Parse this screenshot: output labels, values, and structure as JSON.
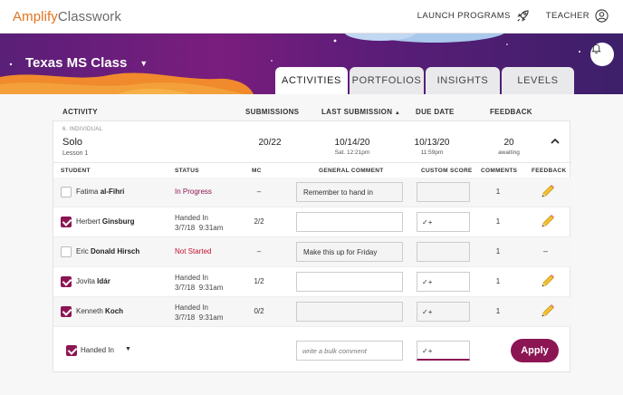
{
  "app": {
    "brand": "Amplify",
    "product": "Classwork",
    "launch_label": "LAUNCH PROGRAMS",
    "user_label": "TEACHER"
  },
  "banner": {
    "class_name": "Texas MS Class"
  },
  "tabs": [
    {
      "label": "ACTIVITIES",
      "active": true
    },
    {
      "label": "PORTFOLIOS",
      "active": false
    },
    {
      "label": "INSIGHTS",
      "active": false
    },
    {
      "label": "LEVELS",
      "active": false
    }
  ],
  "columns": {
    "activity": "ACTIVITY",
    "submissions": "SUBMISSIONS",
    "last_submission": "LAST SUBMISSION",
    "due_date": "DUE DATE",
    "feedback": "FEEDBACK"
  },
  "activity": {
    "type": "6. INDIVIDUAL",
    "name": "Solo",
    "lesson": "Lesson 1",
    "submissions": "20/22",
    "last_submission_date": "10/14/20",
    "last_submission_time": "Sat. 12:21pm",
    "due_date": "10/13/20",
    "due_time": "11:59pm",
    "feedback_count": "20",
    "feedback_sub": "awaiting"
  },
  "student_columns": {
    "student": "STUDENT",
    "status": "STATUS",
    "mc": "MC",
    "general_comment": "GENERAL COMMENT",
    "custom_score": "CUSTOM SCORE",
    "comments": "COMMENTS",
    "feedback": "FEEDBACK"
  },
  "students": [
    {
      "first": "Fatima",
      "last": "al-Fihri",
      "checked": false,
      "status": "In Progress",
      "status_type": "prog",
      "status_date": "",
      "status_time": "",
      "mc": "–",
      "comment": "Remember to hand in",
      "score": "",
      "comments": "1",
      "feedback": "pencil"
    },
    {
      "first": "Herbert",
      "last": "Ginsburg",
      "checked": true,
      "status": "Handed In",
      "status_type": "done",
      "status_date": "3/7/18",
      "status_time": "9:31am",
      "mc": "2/2",
      "comment": "",
      "score": "✓+",
      "comments": "1",
      "feedback": "pencil"
    },
    {
      "first": "Eric",
      "last": "Donald Hirsch",
      "checked": false,
      "status": "Not Started",
      "status_type": "nstart",
      "status_date": "",
      "status_time": "",
      "mc": "–",
      "comment": "Make this up for Friday",
      "score": "",
      "comments": "1",
      "feedback": "–"
    },
    {
      "first": "Jovita",
      "last": "Idár",
      "checked": true,
      "status": "Handed In",
      "status_type": "done",
      "status_date": "3/7/18",
      "status_time": "9:31am",
      "mc": "1/2",
      "comment": "",
      "score": "✓+",
      "comments": "1",
      "feedback": "pencil"
    },
    {
      "first": "Kenneth",
      "last": "Koch",
      "checked": true,
      "status": "Handed In",
      "status_type": "done",
      "status_date": "3/7/18",
      "status_time": "9:31am",
      "mc": "0/2",
      "comment": "",
      "score": "✓+",
      "comments": "1",
      "feedback": "pencil"
    }
  ],
  "bulk": {
    "filter_label": "Handed In",
    "comment_placeholder": "write a bulk comment",
    "score_value": "✓+",
    "apply_label": "Apply"
  },
  "colors": {
    "accent": "#8c1654",
    "brand_orange": "#e2731d",
    "not_started": "#c4122e",
    "pencil": "#f2c12e"
  }
}
